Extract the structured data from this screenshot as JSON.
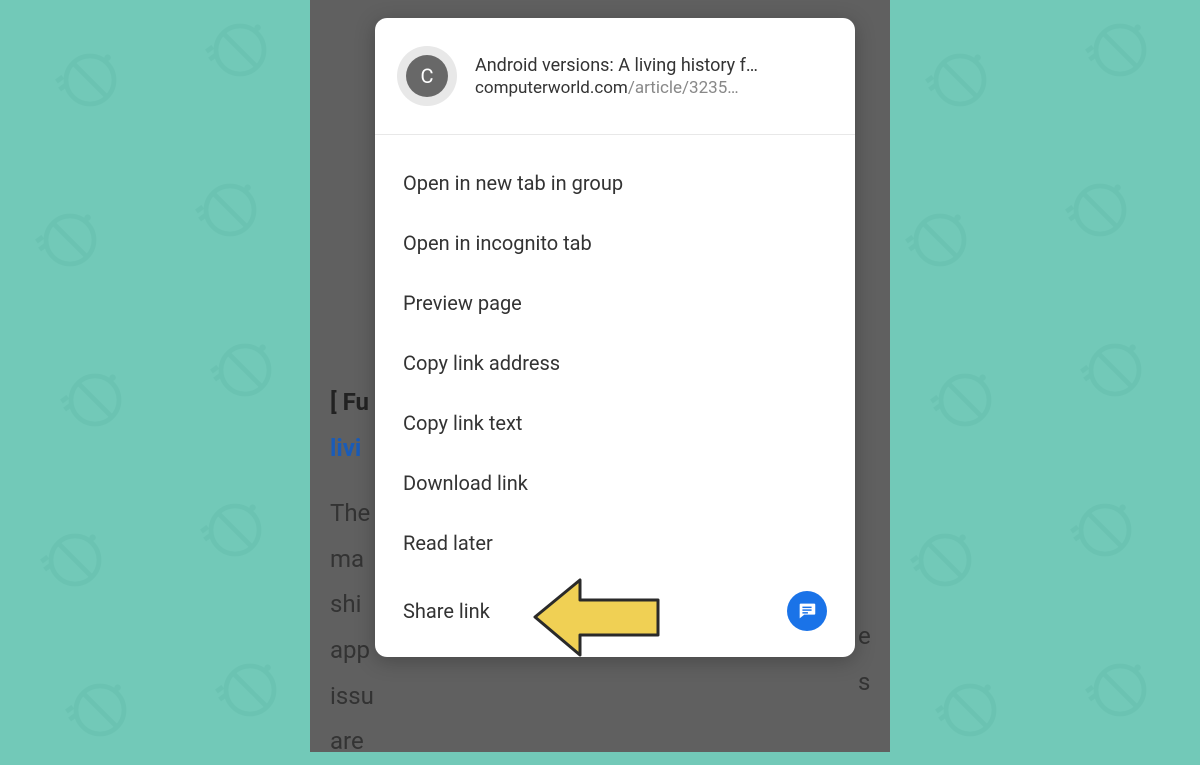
{
  "background": {
    "color": "#72c9b8",
    "icon_stroke": "#4aa893"
  },
  "page_behind": {
    "line1_bold": "[ Fu",
    "line2_link": "livi",
    "body_snippet": "The\nma\nshi\napp\nissu\nare",
    "right_col_snippet": "e\ns"
  },
  "context_menu": {
    "favicon_letter": "C",
    "title": "Android versions: A living history f…",
    "url_domain": "computerworld.com",
    "url_path": "/article/3235…",
    "items": [
      {
        "label": "Open in new tab in group"
      },
      {
        "label": "Open in incognito tab"
      },
      {
        "label": "Preview page"
      },
      {
        "label": "Copy link address"
      },
      {
        "label": "Copy link text"
      },
      {
        "label": "Download link"
      },
      {
        "label": "Read later"
      },
      {
        "label": "Share link",
        "has_share_icon": true
      }
    ]
  },
  "annotation": {
    "arrow_fill": "#f0d054",
    "arrow_stroke": "#2a2a2a"
  }
}
